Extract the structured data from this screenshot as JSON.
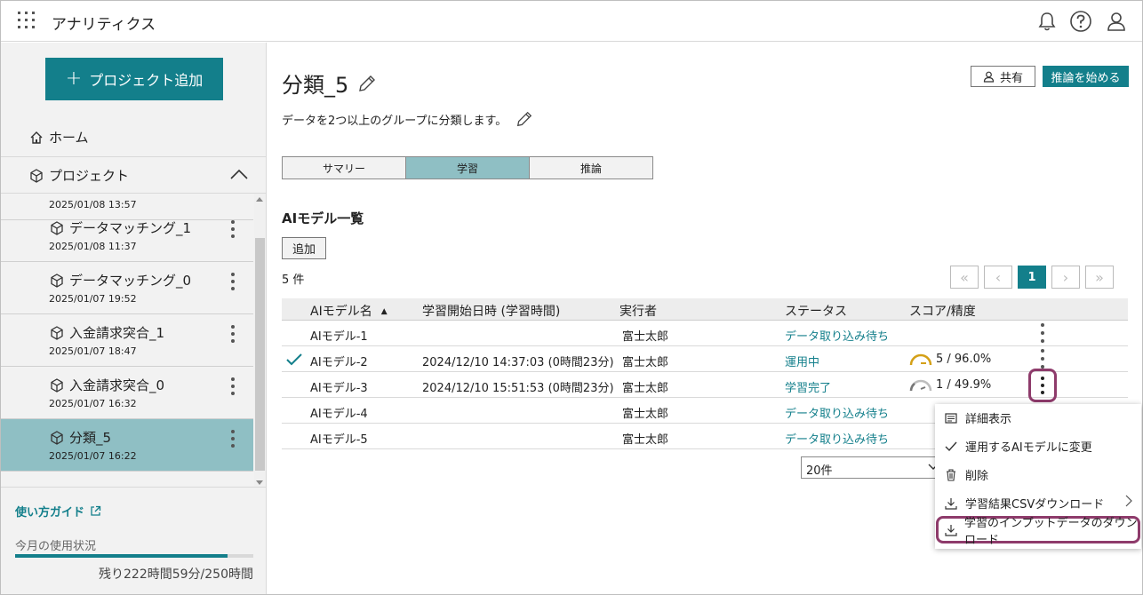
{
  "header": {
    "app_title": "アナリティクス"
  },
  "sidebar": {
    "add_project_label": "プロジェクト追加",
    "home_label": "ホーム",
    "projects_label": "プロジェクト",
    "partial_date": "2025/01/08 13:57",
    "items": [
      {
        "name": "データマッチング_1",
        "date": "2025/01/08 11:37",
        "selected": false
      },
      {
        "name": "データマッチング_0",
        "date": "2025/01/07 19:52",
        "selected": false
      },
      {
        "name": "入金請求突合_1",
        "date": "2025/01/07 18:47",
        "selected": false
      },
      {
        "name": "入金請求突合_0",
        "date": "2025/01/07 16:32",
        "selected": false
      },
      {
        "name": "分類_5",
        "date": "2025/01/07 16:22",
        "selected": true
      }
    ],
    "guide_label": "使い方ガイド",
    "usage_label": "今月の使用状況",
    "usage_fraction": 0.89,
    "usage_text": "残り222時間59分/250時間"
  },
  "main": {
    "title": "分類_5",
    "share_label": "共有",
    "start_inference_label": "推論を始める",
    "description": "データを2つ以上のグループに分類します。",
    "tabs": [
      {
        "label": "サマリー",
        "active": false
      },
      {
        "label": "学習",
        "active": true
      },
      {
        "label": "推論",
        "active": false
      }
    ],
    "section_title": "AIモデル一覧",
    "add_label": "追加",
    "count_label": "5 件",
    "pagination": {
      "first": "«",
      "prev": "‹",
      "current": "1",
      "next": "›",
      "last": "»"
    },
    "table": {
      "columns": [
        "AIモデル名",
        "学習開始日時 (学習時間)",
        "実行者",
        "ステータス",
        "スコア/精度"
      ],
      "sort_indicator": "▲",
      "rows": [
        {
          "name": "AIモデル-1",
          "start": "",
          "user": "富士太郎",
          "status": "データ取り込み待ち",
          "score": "",
          "active": false
        },
        {
          "name": "AIモデル-2",
          "start": "2024/12/10 14:37:03 (0時間23分)",
          "user": "富士太郎",
          "status": "運用中",
          "score": "5 / 96.0%",
          "active": true
        },
        {
          "name": "AIモデル-3",
          "start": "2024/12/10 15:51:53 (0時間23分)",
          "user": "富士太郎",
          "status": "学習完了",
          "score": "1 / 49.9%",
          "active": false
        },
        {
          "name": "AIモデル-4",
          "start": "",
          "user": "富士太郎",
          "status": "データ取り込み待ち",
          "score": "",
          "active": false
        },
        {
          "name": "AIモデル-5",
          "start": "",
          "user": "富士太郎",
          "status": "データ取り込み待ち",
          "score": "",
          "active": false
        }
      ]
    },
    "per_page": "20件"
  },
  "context_menu": {
    "items": [
      {
        "label": "詳細表示",
        "icon": "detail-icon"
      },
      {
        "label": "運用するAIモデルに変更",
        "icon": "check-icon"
      },
      {
        "label": "削除",
        "icon": "trash-icon"
      },
      {
        "label": "学習結果CSVダウンロード",
        "icon": "download-icon"
      },
      {
        "label": "学習のインプットデータのダウンロード",
        "icon": "download-icon"
      }
    ]
  },
  "colors": {
    "accent": "#137f8b",
    "selected": "#8fbfc4",
    "highlight": "#8e3b6b",
    "gauge_good": "#d4a017",
    "gauge_low": "#9a9a9a"
  }
}
